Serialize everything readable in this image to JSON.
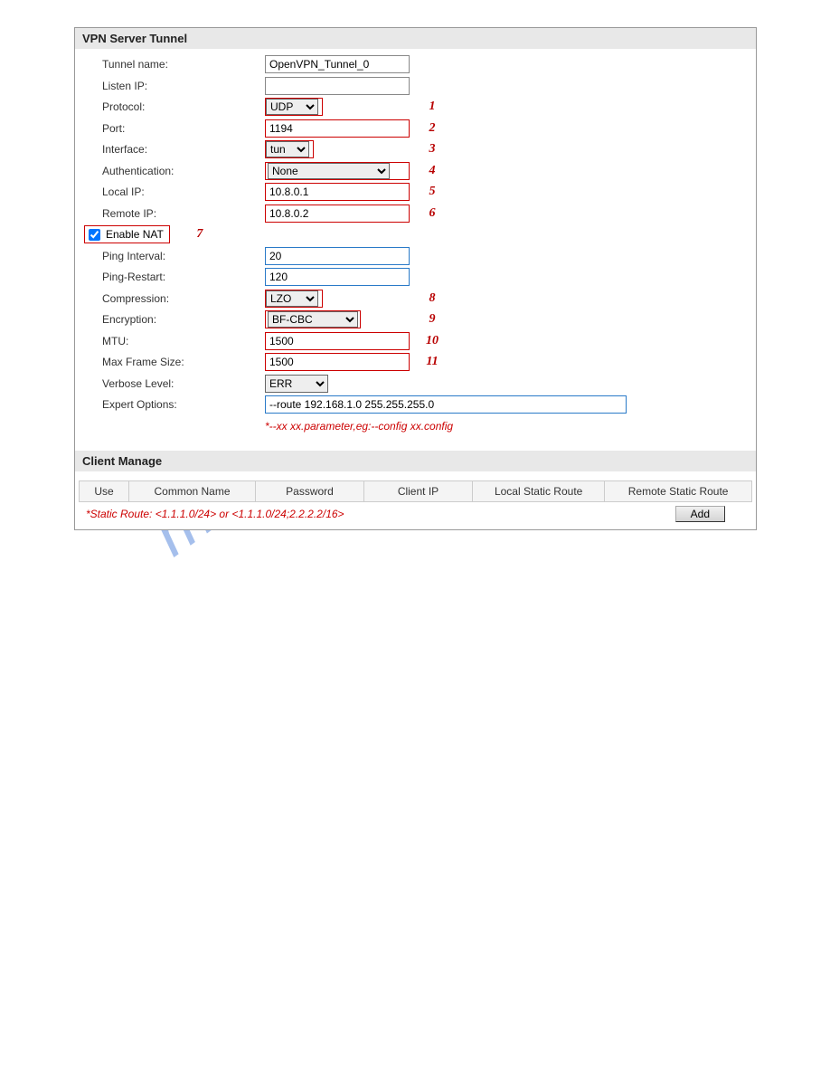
{
  "watermark": "manualshive.com",
  "vpn": {
    "header": "VPN Server Tunnel",
    "labels": {
      "tunnel_name": "Tunnel name:",
      "listen_ip": "Listen IP:",
      "protocol": "Protocol:",
      "port": "Port:",
      "interface": "Interface:",
      "authentication": "Authentication:",
      "local_ip": "Local IP:",
      "remote_ip": "Remote IP:",
      "enable_nat": "Enable NAT",
      "ping_interval": "Ping Interval:",
      "ping_restart": "Ping-Restart:",
      "compression": "Compression:",
      "encryption": "Encryption:",
      "mtu": "MTU:",
      "max_frame_size": "Max Frame Size:",
      "verbose_level": "Verbose Level:",
      "expert_options": "Expert Options:"
    },
    "values": {
      "tunnel_name": "OpenVPN_Tunnel_0",
      "listen_ip": "",
      "protocol": "UDP",
      "port": "1194",
      "interface": "tun",
      "authentication": "None",
      "local_ip": "10.8.0.1",
      "remote_ip": "10.8.0.2",
      "enable_nat": true,
      "ping_interval": "20",
      "ping_restart": "120",
      "compression": "LZO",
      "encryption": "BF-CBC",
      "mtu": "1500",
      "max_frame_size": "1500",
      "verbose_level": "ERR",
      "expert_options": "--route 192.168.1.0 255.255.255.0"
    },
    "markers": {
      "protocol": "1",
      "port": "2",
      "interface": "3",
      "authentication": "4",
      "local_ip": "5",
      "remote_ip": "6",
      "enable_nat": "7",
      "compression": "8",
      "encryption": "9",
      "mtu": "10",
      "max_frame_size": "11"
    },
    "hint": "*--xx xx.parameter,eg:--config xx.config"
  },
  "client": {
    "header": "Client Manage",
    "columns": {
      "use": "Use",
      "common_name": "Common Name",
      "password": "Password",
      "client_ip": "Client IP",
      "local_static_route": "Local Static Route",
      "remote_static_route": "Remote Static Route"
    },
    "hint": "*Static Route: <1.1.1.0/24> or <1.1.1.0/24;2.2.2.2/16>",
    "add_label": "Add"
  }
}
